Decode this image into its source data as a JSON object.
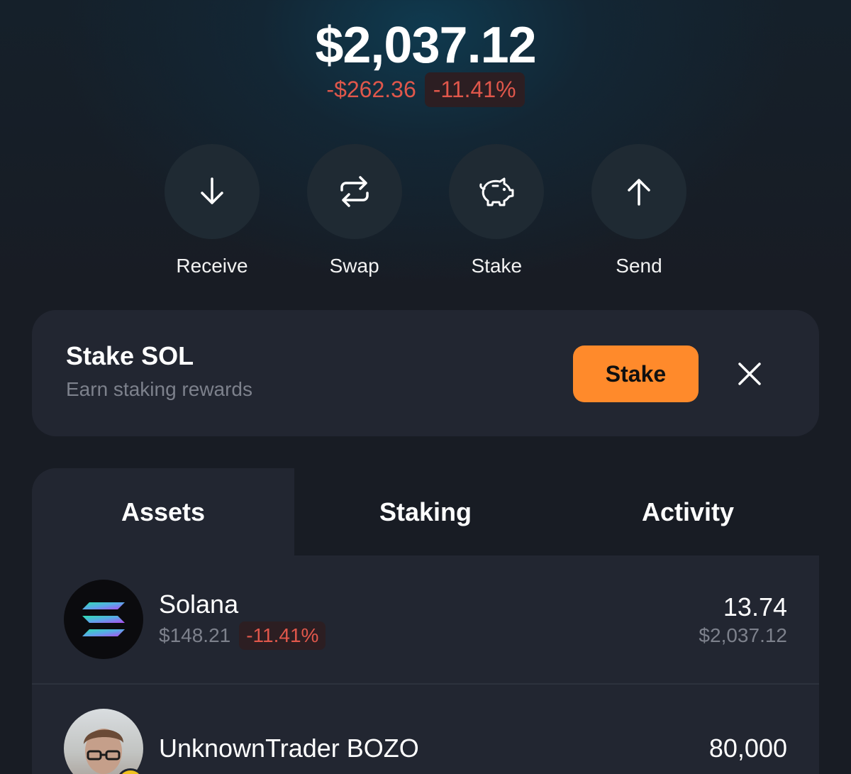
{
  "balance": {
    "total": "$2,037.12",
    "change_amount": "-$262.36",
    "change_percent": "-11.41%"
  },
  "actions": [
    {
      "label": "Receive",
      "icon": "arrow-down-icon"
    },
    {
      "label": "Swap",
      "icon": "swap-icon"
    },
    {
      "label": "Stake",
      "icon": "piggy-bank-icon"
    },
    {
      "label": "Send",
      "icon": "arrow-up-icon"
    }
  ],
  "banner": {
    "title": "Stake SOL",
    "subtitle": "Earn staking rewards",
    "button_label": "Stake",
    "close_icon": "close-icon"
  },
  "tabs": [
    {
      "label": "Assets",
      "active": true
    },
    {
      "label": "Staking",
      "active": false
    },
    {
      "label": "Activity",
      "active": false
    }
  ],
  "assets": [
    {
      "name": "Solana",
      "price": "$148.21",
      "change": "-11.41%",
      "amount": "13.74",
      "value": "$2,037.12",
      "icon": "solana-logo-icon"
    },
    {
      "name": "UnknownTrader BOZO",
      "amount": "80,000",
      "icon": "token-avatar"
    }
  ],
  "colors": {
    "accent": "#ff8a2b",
    "negative": "#e0574b",
    "card": "#222631",
    "background": "#181c24",
    "muted_text": "#7d818c"
  }
}
